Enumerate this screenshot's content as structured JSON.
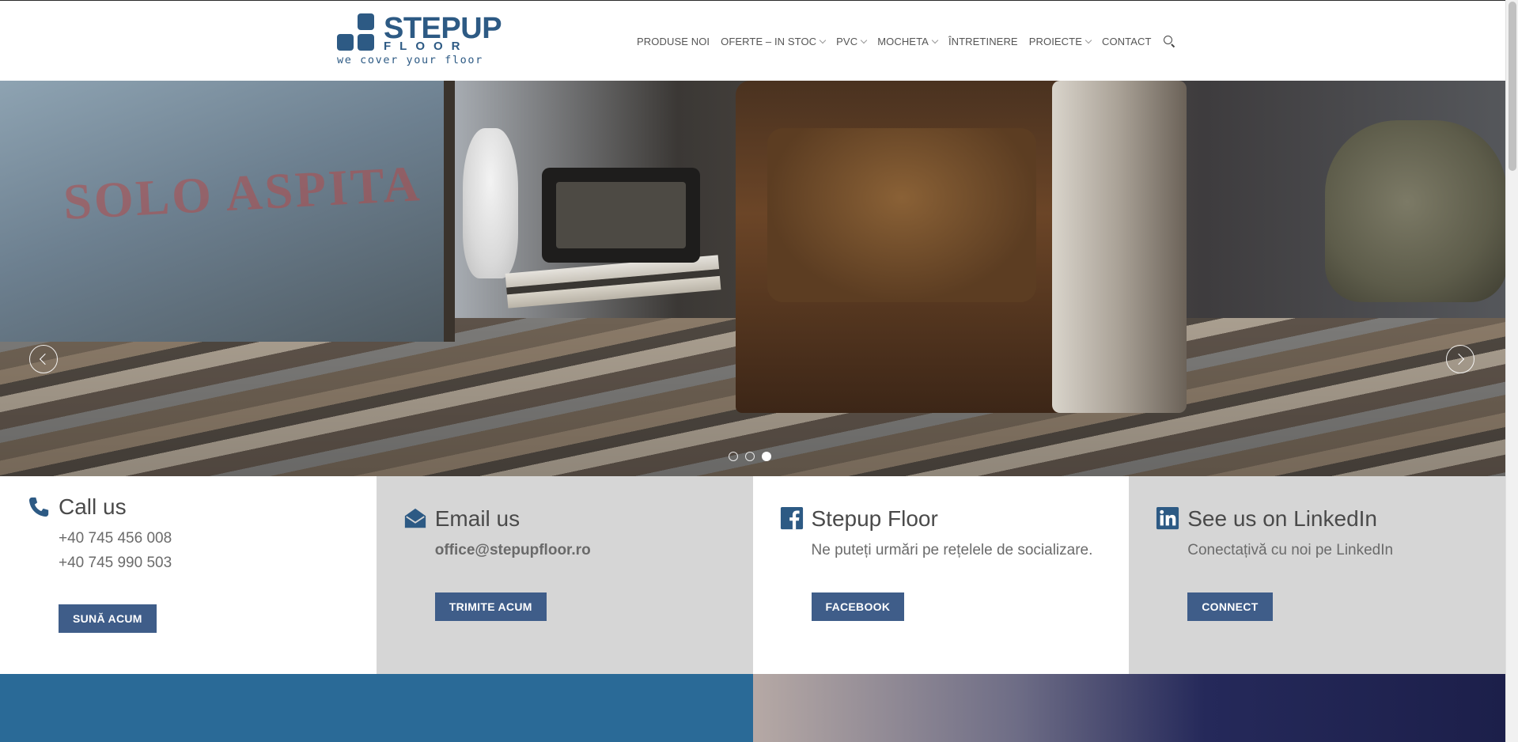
{
  "brand": {
    "name": "STEPUP",
    "sub": "FLOOR",
    "tagline": "we cover your floor",
    "color": "#2d5a84"
  },
  "nav": {
    "items": [
      {
        "label": "PRODUSE NOI",
        "dropdown": false
      },
      {
        "label": "OFERTE – IN STOC",
        "dropdown": true
      },
      {
        "label": "PVC",
        "dropdown": true
      },
      {
        "label": "MOCHETA",
        "dropdown": true
      },
      {
        "label": "ÎNTRETINERE",
        "dropdown": false
      },
      {
        "label": "PROIECTE",
        "dropdown": true
      },
      {
        "label": "CONTACT",
        "dropdown": false
      }
    ],
    "search_icon": "search-icon"
  },
  "hero": {
    "slide_count": 3,
    "active_slide": 3,
    "crate_print": "SOLO ASPITA"
  },
  "contact": {
    "call": {
      "title": "Call us",
      "phone1": "+40 745 456 008",
      "phone2": "+40 745 990 503",
      "button": "SUNĂ ACUM",
      "icon": "phone-icon"
    },
    "email": {
      "title": "Email us",
      "address": "office@stepupfloor.ro",
      "button": "TRIMITE ACUM",
      "icon": "envelope-icon"
    },
    "facebook": {
      "title": "Stepup Floor",
      "text": "Ne puteți urmări pe rețelele de socializare.",
      "button": "FACEBOOK",
      "icon": "facebook-icon"
    },
    "linkedin": {
      "title": "See us on LinkedIn",
      "text": "Conectațivă cu noi pe LinkedIn",
      "button": "CONNECT",
      "icon": "linkedin-icon"
    }
  },
  "colors": {
    "accent_button": "#3f5d89",
    "gray_panel": "#d6d6d6",
    "bottom_blue": "#2a6a97"
  }
}
